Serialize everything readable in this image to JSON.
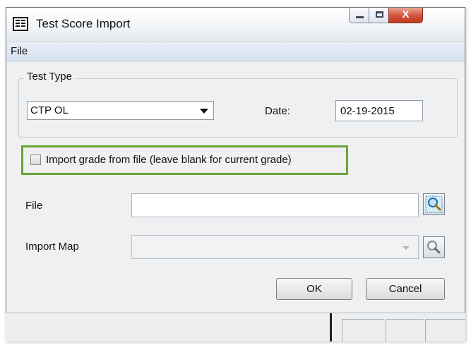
{
  "window": {
    "title": "Test Score Import",
    "icon": "form-icon",
    "controls": [
      "minimize-icon",
      "maximize-icon",
      "close-icon"
    ],
    "close_glyph": "X"
  },
  "menu": {
    "file_label": "File"
  },
  "test_type": {
    "group_label": "Test Type",
    "selected": "CTP OL",
    "date_label": "Date:",
    "date_value": "02-19-2015"
  },
  "import_grade": {
    "label": "Import grade from file (leave blank for current grade)",
    "checked": false,
    "highlight_color": "#6ba539"
  },
  "file": {
    "label": "File",
    "value": "",
    "browse_icon": "magnifier-icon"
  },
  "import_map": {
    "label": "Import Map",
    "value": "",
    "browse_icon": "magnifier-icon"
  },
  "buttons": {
    "ok": "OK",
    "cancel": "Cancel"
  }
}
